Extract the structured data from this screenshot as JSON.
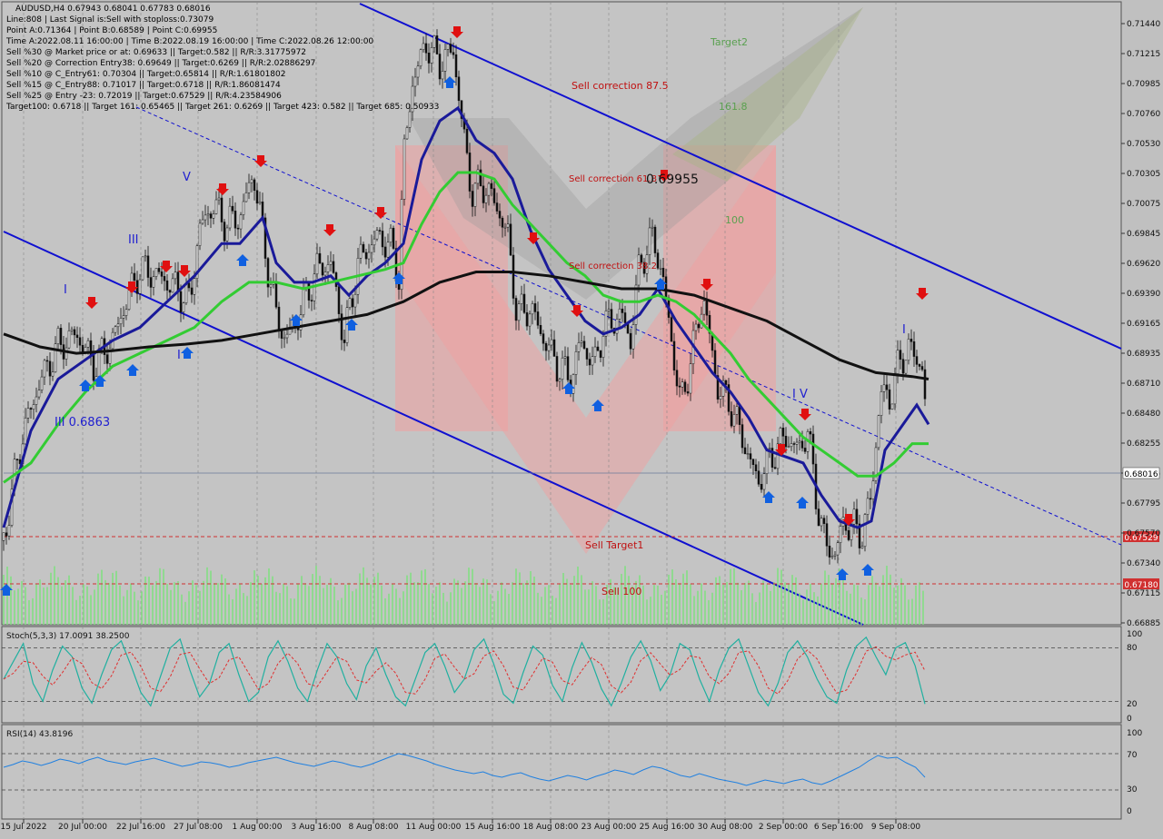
{
  "header": {
    "symbol_line": "AUDUSD,H4  0.67943 0.68041 0.67783 0.68016",
    "lines": [
      "Line:808 | Last Signal is:Sell with stoploss:0.73079",
      "Point A:0.71364 | Point B:0.68589 | Point C:0.69955",
      "Time A:2022.08.11 16:00:00 | Time B:2022.08.19 16:00:00 | Time C:2022.08.26 12:00:00",
      "Sell %30 @ Market price or at: 0.69633 || Target:0.582 || R/R:3.31775972",
      "Sell %20 @ Correction Entry38: 0.69649 || Target:0.6269 || R/R:2.02886297",
      "Sell %10 @ C_Entry61: 0.70304 || Target:0.65814 || R/R:1.61801802",
      "Sell %15 @ C_Entry88: 0.71017 || Target:0.6718 || R/R:1.86081474",
      "Sell %25 @ Entry -23: 0.72019 || Target:0.67529 || R/R:4.23584906",
      "Target100: 0.6718 || Target 161: 0.65465 || Target 261: 0.6269 || Target 423: 0.582 || Target 685: 0.50933"
    ]
  },
  "chart_data": {
    "type": "candlestick",
    "symbol": "AUDUSD",
    "timeframe": "H4",
    "last_price": "0.68016",
    "price_axis": {
      "ticks": [
        "0.71440",
        "0.71215",
        "0.70985",
        "0.70760",
        "0.70530",
        "0.70305",
        "0.70075",
        "0.69845",
        "0.69620",
        "0.69390",
        "0.69165",
        "0.68935",
        "0.68710",
        "0.68480",
        "0.68255",
        "0.68025",
        "0.67795",
        "0.67570",
        "0.67340",
        "0.67115",
        "0.66885"
      ],
      "range": [
        0.6684,
        0.7158
      ]
    },
    "time_axis": [
      "15 Jul 2022",
      "20 Jul 00:00",
      "22 Jul 16:00",
      "27 Jul 08:00",
      "1 Aug 00:00",
      "3 Aug 16:00",
      "8 Aug 08:00",
      "11 Aug 00:00",
      "15 Aug 16:00",
      "18 Aug 08:00",
      "23 Aug 00:00",
      "25 Aug 16:00",
      "30 Aug 08:00",
      "2 Sep 00:00",
      "6 Sep 16:00",
      "9 Sep 08:00"
    ],
    "close_path": [
      [
        0,
        0.6745
      ],
      [
        20,
        0.6825
      ],
      [
        40,
        0.6868
      ],
      [
        60,
        0.6895
      ],
      [
        80,
        0.6905
      ],
      [
        100,
        0.688
      ],
      [
        120,
        0.69
      ],
      [
        135,
        0.693
      ],
      [
        150,
        0.6955
      ],
      [
        170,
        0.695
      ],
      [
        190,
        0.694
      ],
      [
        205,
        0.693
      ],
      [
        215,
        0.6985
      ],
      [
        230,
        0.7005
      ],
      [
        245,
        0.699
      ],
      [
        260,
        0.6995
      ],
      [
        275,
        0.703
      ],
      [
        290,
        0.696
      ],
      [
        300,
        0.692
      ],
      [
        310,
        0.69
      ],
      [
        325,
        0.692
      ],
      [
        345,
        0.6955
      ],
      [
        360,
        0.696
      ],
      [
        375,
        0.69
      ],
      [
        390,
        0.696
      ],
      [
        410,
        0.698
      ],
      [
        425,
        0.6975
      ],
      [
        435,
        0.695
      ],
      [
        440,
        0.704
      ],
      [
        450,
        0.71
      ],
      [
        465,
        0.713
      ],
      [
        480,
        0.7115
      ],
      [
        495,
        0.7125
      ],
      [
        505,
        0.7065
      ],
      [
        515,
        0.7015
      ],
      [
        530,
        0.702
      ],
      [
        545,
        0.7
      ],
      [
        555,
        0.698
      ],
      [
        565,
        0.692
      ],
      [
        580,
        0.6925
      ],
      [
        595,
        0.69
      ],
      [
        610,
        0.688
      ],
      [
        625,
        0.687
      ],
      [
        635,
        0.69
      ],
      [
        650,
        0.688
      ],
      [
        660,
        0.691
      ],
      [
        680,
        0.692
      ],
      [
        690,
        0.69
      ],
      [
        700,
        0.696
      ],
      [
        715,
        0.698
      ],
      [
        725,
        0.695
      ],
      [
        735,
        0.69
      ],
      [
        745,
        0.685
      ],
      [
        755,
        0.688
      ],
      [
        770,
        0.6935
      ],
      [
        785,
        0.6865
      ],
      [
        800,
        0.685
      ],
      [
        815,
        0.682
      ],
      [
        830,
        0.679
      ],
      [
        845,
        0.681
      ],
      [
        860,
        0.6825
      ],
      [
        875,
        0.6815
      ],
      [
        885,
        0.683
      ],
      [
        895,
        0.6775
      ],
      [
        905,
        0.674
      ],
      [
        915,
        0.6735
      ],
      [
        925,
        0.676
      ],
      [
        935,
        0.6755
      ],
      [
        945,
        0.675
      ],
      [
        955,
        0.678
      ],
      [
        965,
        0.686
      ],
      [
        975,
        0.6855
      ],
      [
        985,
        0.688
      ],
      [
        995,
        0.6895
      ],
      [
        1005,
        0.6885
      ],
      [
        1012,
        0.688
      ],
      [
        1018,
        0.68
      ]
    ],
    "moving_averages": [
      {
        "color": "#1a1a99",
        "period": "fast",
        "points": [
          [
            0,
            0.6755
          ],
          [
            30,
            0.683
          ],
          [
            60,
            0.687
          ],
          [
            90,
            0.6885
          ],
          [
            120,
            0.69
          ],
          [
            150,
            0.691
          ],
          [
            180,
            0.693
          ],
          [
            210,
            0.695
          ],
          [
            240,
            0.6975
          ],
          [
            260,
            0.6975
          ],
          [
            285,
            0.6995
          ],
          [
            300,
            0.696
          ],
          [
            320,
            0.6945
          ],
          [
            340,
            0.6945
          ],
          [
            360,
            0.695
          ],
          [
            380,
            0.6935
          ],
          [
            400,
            0.695
          ],
          [
            420,
            0.696
          ],
          [
            440,
            0.6975
          ],
          [
            460,
            0.704
          ],
          [
            480,
            0.707
          ],
          [
            500,
            0.708
          ],
          [
            520,
            0.7055
          ],
          [
            540,
            0.7045
          ],
          [
            560,
            0.7025
          ],
          [
            580,
            0.6985
          ],
          [
            600,
            0.6955
          ],
          [
            620,
            0.6935
          ],
          [
            640,
            0.6915
          ],
          [
            660,
            0.6905
          ],
          [
            680,
            0.691
          ],
          [
            700,
            0.692
          ],
          [
            720,
            0.694
          ],
          [
            740,
            0.6915
          ],
          [
            760,
            0.6895
          ],
          [
            780,
            0.6875
          ],
          [
            800,
            0.686
          ],
          [
            820,
            0.684
          ],
          [
            840,
            0.6815
          ],
          [
            860,
            0.681
          ],
          [
            880,
            0.6805
          ],
          [
            900,
            0.678
          ],
          [
            920,
            0.676
          ],
          [
            940,
            0.6755
          ],
          [
            955,
            0.676
          ],
          [
            970,
            0.6815
          ],
          [
            990,
            0.6835
          ],
          [
            1005,
            0.685
          ],
          [
            1018,
            0.6835
          ]
        ]
      },
      {
        "color": "#33cc33",
        "period": "medium",
        "points": [
          [
            0,
            0.679
          ],
          [
            30,
            0.6805
          ],
          [
            60,
            0.6835
          ],
          [
            90,
            0.686
          ],
          [
            120,
            0.688
          ],
          [
            150,
            0.689
          ],
          [
            180,
            0.69
          ],
          [
            210,
            0.691
          ],
          [
            240,
            0.693
          ],
          [
            270,
            0.6945
          ],
          [
            300,
            0.6945
          ],
          [
            330,
            0.694
          ],
          [
            360,
            0.6945
          ],
          [
            390,
            0.695
          ],
          [
            420,
            0.6955
          ],
          [
            440,
            0.696
          ],
          [
            460,
            0.699
          ],
          [
            480,
            0.7015
          ],
          [
            500,
            0.703
          ],
          [
            520,
            0.703
          ],
          [
            540,
            0.7025
          ],
          [
            560,
            0.7005
          ],
          [
            580,
            0.699
          ],
          [
            600,
            0.6975
          ],
          [
            620,
            0.696
          ],
          [
            640,
            0.695
          ],
          [
            660,
            0.6935
          ],
          [
            680,
            0.693
          ],
          [
            700,
            0.693
          ],
          [
            720,
            0.6935
          ],
          [
            740,
            0.693
          ],
          [
            760,
            0.692
          ],
          [
            780,
            0.6905
          ],
          [
            800,
            0.689
          ],
          [
            820,
            0.687
          ],
          [
            840,
            0.6855
          ],
          [
            860,
            0.684
          ],
          [
            880,
            0.6825
          ],
          [
            900,
            0.6815
          ],
          [
            920,
            0.6805
          ],
          [
            940,
            0.6795
          ],
          [
            960,
            0.6795
          ],
          [
            980,
            0.6805
          ],
          [
            1000,
            0.682
          ],
          [
            1018,
            0.682
          ]
        ]
      },
      {
        "color": "#111111",
        "period": "slow",
        "points": [
          [
            0,
            0.6905
          ],
          [
            40,
            0.6895
          ],
          [
            80,
            0.689
          ],
          [
            120,
            0.6892
          ],
          [
            160,
            0.6895
          ],
          [
            200,
            0.6897
          ],
          [
            240,
            0.69
          ],
          [
            280,
            0.6905
          ],
          [
            320,
            0.691
          ],
          [
            360,
            0.6915
          ],
          [
            400,
            0.692
          ],
          [
            440,
            0.693
          ],
          [
            480,
            0.6945
          ],
          [
            520,
            0.6953
          ],
          [
            560,
            0.6953
          ],
          [
            600,
            0.695
          ],
          [
            640,
            0.6945
          ],
          [
            680,
            0.694
          ],
          [
            720,
            0.694
          ],
          [
            760,
            0.6935
          ],
          [
            800,
            0.6925
          ],
          [
            840,
            0.6915
          ],
          [
            880,
            0.69
          ],
          [
            920,
            0.6885
          ],
          [
            960,
            0.6875
          ],
          [
            1000,
            0.6872
          ],
          [
            1018,
            0.687
          ]
        ]
      }
    ],
    "annotations": [
      "Target2",
      "161.8",
      "100",
      "Sell correction 87.5",
      "Sell correction 61.8",
      "Sell correction 38.2",
      "0.69955",
      "Sell Target1",
      "Sell 100",
      "I",
      "III",
      "V",
      "I V",
      "I",
      "III 0.6863",
      "I"
    ],
    "levels": [
      {
        "label": "0.67529",
        "color": "#d03030"
      },
      {
        "label": "0.67180",
        "color": "#d03030"
      }
    ],
    "stoch": {
      "label": "Stoch(5,3,3) 17.0091 38.2500",
      "ticks": [
        "100",
        "80",
        "20",
        "0"
      ],
      "main": [
        45,
        65,
        85,
        40,
        20,
        55,
        82,
        70,
        35,
        18,
        50,
        78,
        88,
        60,
        30,
        15,
        48,
        80,
        90,
        55,
        25,
        40,
        75,
        85,
        50,
        20,
        30,
        70,
        88,
        65,
        35,
        20,
        55,
        85,
        70,
        40,
        22,
        60,
        80,
        50,
        25,
        15,
        45,
        75,
        85,
        60,
        30,
        45,
        78,
        90,
        62,
        28,
        18,
        52,
        82,
        72,
        38,
        20,
        58,
        86,
        64,
        34,
        15,
        40,
        70,
        88,
        66,
        32,
        50,
        85,
        78,
        45,
        20,
        55,
        80,
        90,
        60,
        30,
        15,
        40,
        75,
        88,
        70,
        45,
        25,
        18,
        55,
        82,
        92,
        70,
        50,
        80,
        86,
        60,
        17
      ]
    },
    "rsi": {
      "label": "RSI(14) 43.8196",
      "ticks": [
        "100",
        "70",
        "30",
        "0"
      ],
      "values": [
        55,
        58,
        62,
        60,
        57,
        60,
        64,
        62,
        59,
        63,
        66,
        62,
        60,
        58,
        61,
        63,
        65,
        62,
        59,
        56,
        58,
        61,
        60,
        58,
        55,
        57,
        60,
        62,
        64,
        66,
        63,
        60,
        58,
        56,
        59,
        62,
        60,
        57,
        55,
        58,
        62,
        66,
        70,
        68,
        65,
        62,
        58,
        55,
        52,
        50,
        48,
        50,
        46,
        44,
        47,
        49,
        45,
        42,
        40,
        43,
        46,
        44,
        41,
        45,
        48,
        52,
        50,
        47,
        52,
        56,
        54,
        50,
        46,
        44,
        48,
        45,
        42,
        40,
        38,
        35,
        38,
        41,
        39,
        37,
        40,
        42,
        38,
        36,
        40,
        45,
        50,
        55,
        62,
        68,
        65,
        66,
        60,
        55,
        44
      ]
    }
  }
}
